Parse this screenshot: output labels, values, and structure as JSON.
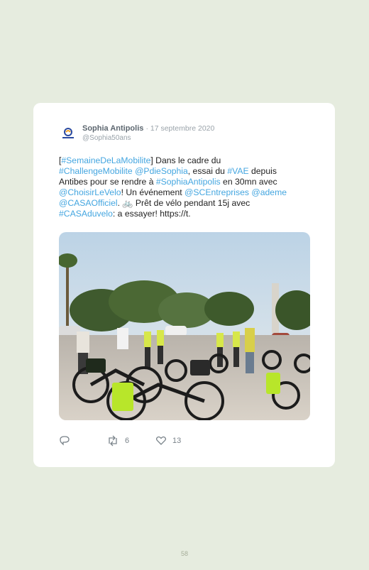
{
  "tweet": {
    "author_name": "Sophia Antipolis",
    "date": "· 17 septembre 2020",
    "handle": "@Sophia50ans",
    "text_segments": [
      {
        "t": "[",
        "tag": false
      },
      {
        "t": "#SemaineDeLaMobilite",
        "tag": true
      },
      {
        "t": "] Dans le cadre du",
        "tag": false
      },
      {
        "t": "#ChallengeMobilite",
        "tag": true
      },
      {
        "t": " ",
        "tag": false
      },
      {
        "t": "@PdieSophia",
        "tag": true
      },
      {
        "t": ", essai du ",
        "tag": false
      },
      {
        "t": "#VAE",
        "tag": true
      },
      {
        "t": " depuis",
        "tag": false
      },
      {
        "t": "Antibes pour se rendre à ",
        "tag": false
      },
      {
        "t": "#SophiaAntipolis",
        "tag": true
      },
      {
        "t": " en 30mn avec",
        "tag": false
      },
      {
        "t": "@ChoisirLeVelo",
        "tag": true
      },
      {
        "t": "! Un événement ",
        "tag": false
      },
      {
        "t": "@SCEntreprises",
        "tag": true
      },
      {
        "t": " ",
        "tag": false
      },
      {
        "t": "@ademe",
        "tag": true
      },
      {
        "t": "@CASAOfficiel",
        "tag": true
      },
      {
        "t": ". 🚲 Prêt de vélo pendant 15j avec",
        "tag": false
      },
      {
        "t": "#CASAduvelo",
        "tag": true
      },
      {
        "t": ": a essayer! https://t.",
        "tag": false
      }
    ],
    "lines": [
      [
        0,
        1,
        2
      ],
      [
        3,
        4,
        5,
        6,
        7,
        8
      ],
      [
        9,
        10,
        11
      ],
      [
        12,
        13,
        14,
        15,
        16
      ],
      [
        17,
        18
      ],
      [
        19,
        20
      ]
    ],
    "reply_count": "",
    "retweet_count": "6",
    "like_count": "13"
  },
  "page_number": "58",
  "colors": {
    "background": "#e6ecdf",
    "card": "#ffffff",
    "link": "#44a6e0"
  },
  "icons": {
    "reply": "reply-icon",
    "retweet": "retweet-icon",
    "like": "heart-icon",
    "avatar": "sophia-antipolis-logo"
  }
}
